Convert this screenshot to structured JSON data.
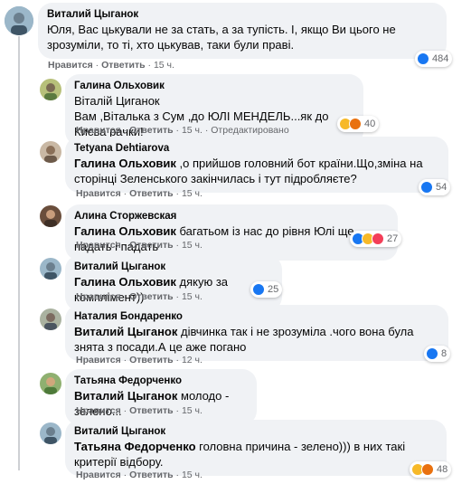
{
  "comments": [
    {
      "author": "Виталий Цыганок",
      "text": "Юля, Вас цькували не за стать, а за тупість. І, якщо Ви цього не зрозуміли, то ті, хто цькував, таки були праві.",
      "like": "Нравится",
      "reply": "Ответить",
      "time": "15 ч.",
      "reaction_count": "484",
      "reactions": [
        "like-icon"
      ]
    },
    {
      "author": "Галина Ольховик",
      "text": "Віталій Циганок\nВам ,Віталька з Сум ,до ЮЛІ МЕНДЕЛЬ...як до Києва рачки!",
      "like": "Нравится",
      "reply": "Ответить",
      "time": "15 ч.",
      "edited": "Отредактировано",
      "reaction_count": "40",
      "reactions": [
        "haha-icon",
        "angry-icon"
      ]
    },
    {
      "author": "Tetyana Dehtiarova",
      "mention": "Галина Ольховик",
      "text": ",о прийшов головний бот країни.Що,зміна на сторінці Зеленського закінчилась і тут підробляєте?",
      "like": "Нравится",
      "reply": "Ответить",
      "time": "15 ч.",
      "reaction_count": "54",
      "reactions": [
        "like-icon"
      ]
    },
    {
      "author": "Алина Сторжевская",
      "mention": "Галина Ольховик",
      "text": "багатьом із нас до рівня Юлі ще падать і падать",
      "like": "Нравится",
      "reply": "Ответить",
      "time": "15 ч.",
      "reaction_count": "27",
      "reactions": [
        "like-icon",
        "haha-icon",
        "love-icon"
      ]
    },
    {
      "author": "Виталий Цыганок",
      "mention": "Галина Ольховик",
      "text": "дякую за комплімент))",
      "like": "Нравится",
      "reply": "Ответить",
      "time": "15 ч.",
      "reaction_count": "25",
      "reactions": [
        "like-icon"
      ]
    },
    {
      "author": "Наталия Бондаренко",
      "mention": "Виталий Цыганок",
      "text": "дівчинка так і не зрозуміла .чого вона була знята з посади.А це аже погано",
      "like": "Нравится",
      "reply": "Ответить",
      "time": "12 ч.",
      "reaction_count": "8",
      "reactions": [
        "like-icon"
      ]
    },
    {
      "author": "Татьяна Федорченко",
      "mention": "Виталий Цыганок",
      "text": "молодо - зелено...",
      "like": "Нравится",
      "reply": "Ответить",
      "time": "15 ч.",
      "reaction_count": "",
      "reactions": []
    },
    {
      "author": "Виталий Цыганок",
      "mention": "Татьяна Федорченко",
      "text": "головна причина - зелено))) в них такі критерії відбору.",
      "like": "Нравится",
      "reply": "Ответить",
      "time": "15 ч.",
      "reaction_count": "48",
      "reactions": [
        "haha-icon",
        "angry-icon"
      ]
    }
  ],
  "colors": {
    "bubble": "#f0f2f5",
    "meta": "#65676b",
    "like": "#1877f2",
    "haha": "#f7b928",
    "love": "#f33e58",
    "angry": "#e9710f"
  }
}
